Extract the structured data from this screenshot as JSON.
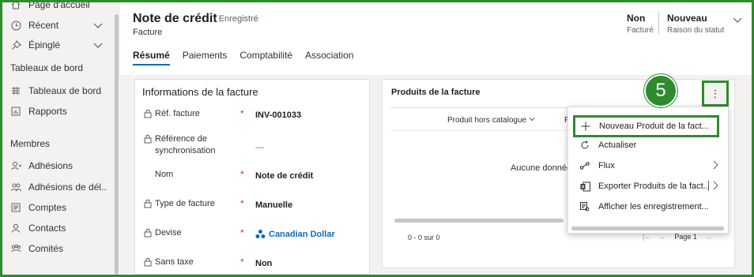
{
  "sidebar": {
    "items_top": [
      {
        "label": "Page d'accueil",
        "icon": "home-icon"
      },
      {
        "label": "Récent",
        "icon": "clock-icon"
      },
      {
        "label": "Épinglé",
        "icon": "pin-icon"
      }
    ],
    "section_dashboards": "Tableaux de bord",
    "dashboards": [
      {
        "label": "Tableaux de bord",
        "icon": "dashboard-icon"
      },
      {
        "label": "Rapports",
        "icon": "report-icon"
      }
    ],
    "section_members": "Membres",
    "members": [
      {
        "label": "Adhésions",
        "icon": "membership-icon"
      },
      {
        "label": "Adhésions de dél...",
        "icon": "delegate-membership-icon"
      },
      {
        "label": "Comptes",
        "icon": "account-icon"
      },
      {
        "label": "Contacts",
        "icon": "contact-icon"
      },
      {
        "label": "Comités",
        "icon": "committee-icon"
      }
    ]
  },
  "header": {
    "title": "Note de crédit",
    "saved_status": "- Enregistré",
    "entity": "Facture",
    "field1": {
      "value": "Non",
      "label": "Facturé"
    },
    "field2": {
      "value": "Nouveau",
      "label": "Raison du statut"
    },
    "tabs": [
      "Résumé",
      "Paiements",
      "Comptabilité",
      "Association"
    ]
  },
  "invoice_info": {
    "title": "Informations de la facture",
    "fields": [
      {
        "label": "Réf. facture",
        "value": "INV-001033",
        "required": "*",
        "locked": true
      },
      {
        "label": "Référence de synchronisation",
        "value": "---",
        "required": "",
        "locked": true
      },
      {
        "label": "Nom",
        "value": "Note de crédit",
        "required": "*",
        "locked": false
      },
      {
        "label": "Type de facture",
        "value": "Manuelle",
        "required": "*",
        "locked": true
      },
      {
        "label": "Devise",
        "value": "Canadian Dollar",
        "required": "*",
        "locked": true
      },
      {
        "label": "Sans taxe",
        "value": "Non",
        "required": "*",
        "locked": true
      }
    ]
  },
  "products": {
    "title": "Produits de la facture",
    "column1": "Produit hors catalogue",
    "column2": "P",
    "no_data": "Aucune donnée",
    "count": "0 - 0 sur 0",
    "page": "Page 1",
    "more_button": "⋮"
  },
  "step_badge": "5",
  "menu": {
    "items": [
      {
        "label": "Nouveau Produit de la fact...",
        "icon": "plus-icon"
      },
      {
        "label": "Actualiser",
        "icon": "refresh-icon"
      },
      {
        "label": "Flux",
        "icon": "flow-icon"
      },
      {
        "label": "Exporter Produits de la fact...",
        "icon": "excel-icon"
      },
      {
        "label": "Afficher les enregistrement...",
        "icon": "view-records-icon"
      }
    ]
  },
  "colors": {
    "accent_green": "#2e8b2e",
    "link_blue": "#0f6cbd",
    "required_red": "#c4314b"
  }
}
